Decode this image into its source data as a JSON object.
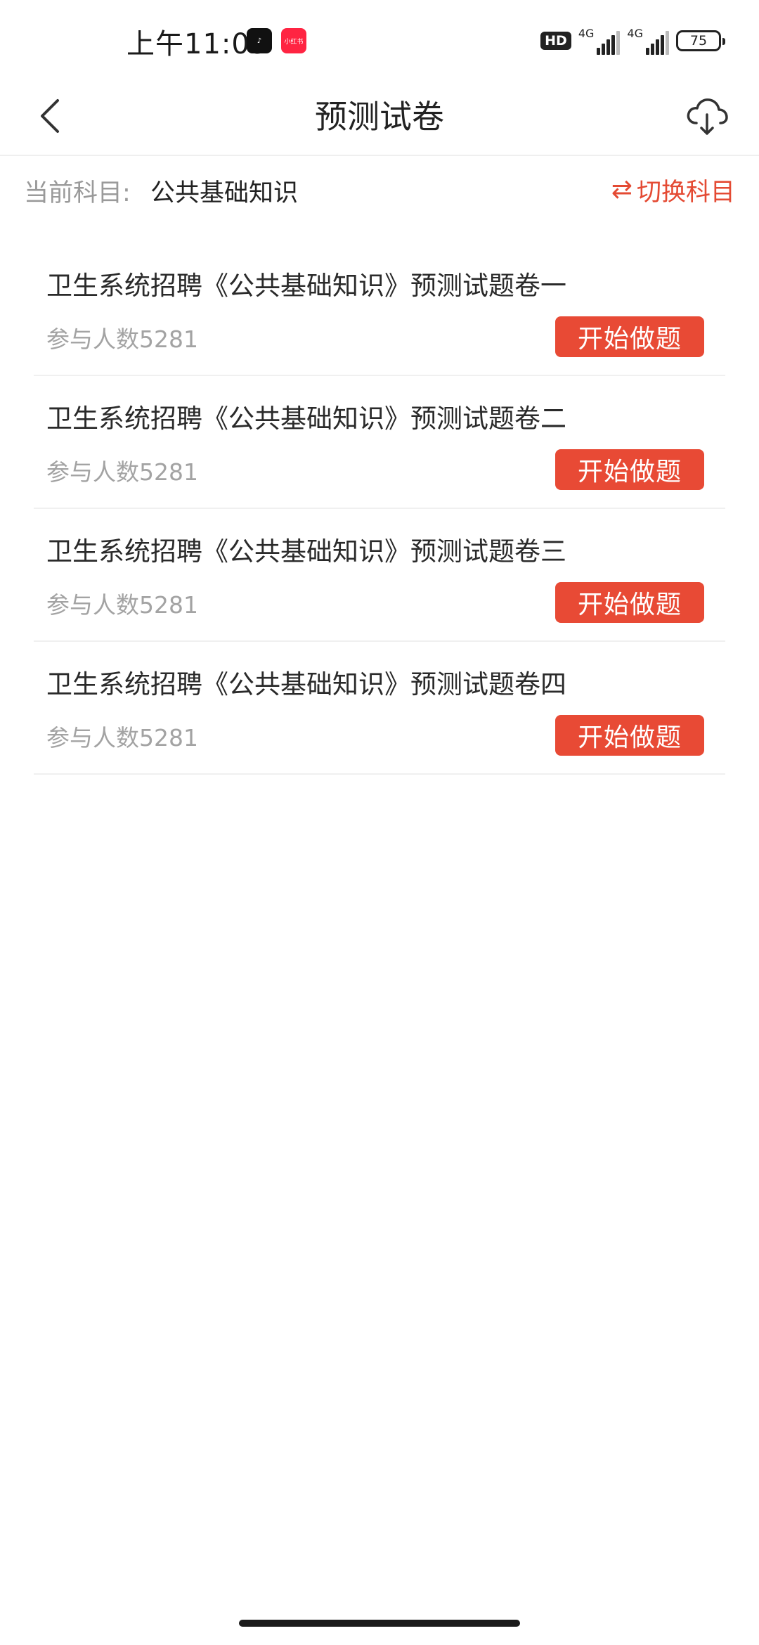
{
  "status_bar": {
    "time": "上午11:09",
    "apps": [
      "tiktok-icon",
      "xiaohongshu-icon"
    ],
    "xhs_label": "小红书",
    "hd": "HD",
    "net1": "4G",
    "net2": "4G",
    "battery": "75"
  },
  "header": {
    "title": "预测试卷",
    "back_icon": "back-chevron-icon",
    "download_icon": "cloud-download-icon"
  },
  "subject": {
    "label": "当前科目:",
    "value": "公共基础知识",
    "switch_label": "切换科目",
    "switch_icon": "⇄"
  },
  "papers": [
    {
      "title": "卫生系统招聘《公共基础知识》预测试题卷一",
      "count": "参与人数5281",
      "button": "开始做题"
    },
    {
      "title": "卫生系统招聘《公共基础知识》预测试题卷二",
      "count": "参与人数5281",
      "button": "开始做题"
    },
    {
      "title": "卫生系统招聘《公共基础知识》预测试题卷三",
      "count": "参与人数5281",
      "button": "开始做题"
    },
    {
      "title": "卫生系统招聘《公共基础知识》预测试题卷四",
      "count": "参与人数5281",
      "button": "开始做题"
    }
  ],
  "colors": {
    "accent": "#e84a35",
    "switch_text": "#e44a33"
  }
}
